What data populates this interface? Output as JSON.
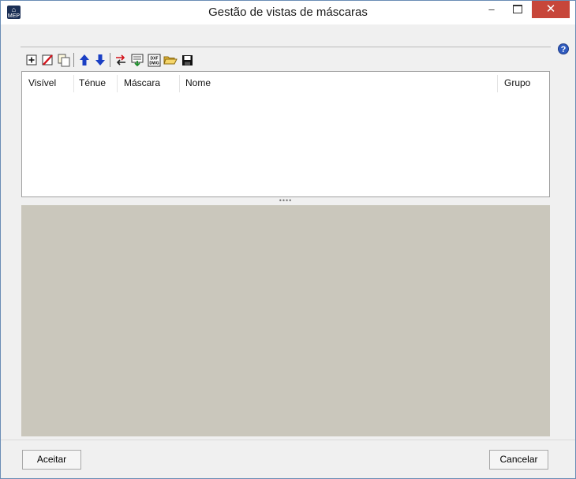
{
  "window": {
    "title": "Gestão de vistas de máscaras",
    "app_icon": "MEP",
    "minimize_icon": "–",
    "close_icon": "✕",
    "help_icon": "?"
  },
  "toolbar": {
    "icons": [
      "add-icon",
      "delete-icon",
      "copy-icon",
      "move-up-icon",
      "move-down-icon",
      "swap-icon",
      "import-mask-icon",
      "dxf-dwg-icon",
      "open-folder-icon",
      "save-icon"
    ],
    "dxf_label": "DXF DWG"
  },
  "grid": {
    "columns": [
      "Visível",
      "Ténue",
      "Máscara",
      "Nome",
      "Grupo"
    ],
    "rows": []
  },
  "splitter": {
    "grip": "••••"
  },
  "buttons": {
    "ok": "Aceitar",
    "cancel": "Cancelar"
  },
  "colors": {
    "title_bar": "#ffffff",
    "close_button": "#c7463a",
    "canvas_background": "#cac7bc",
    "up_arrow": "#1a3fc4",
    "help_button": "#2f5bbf"
  }
}
